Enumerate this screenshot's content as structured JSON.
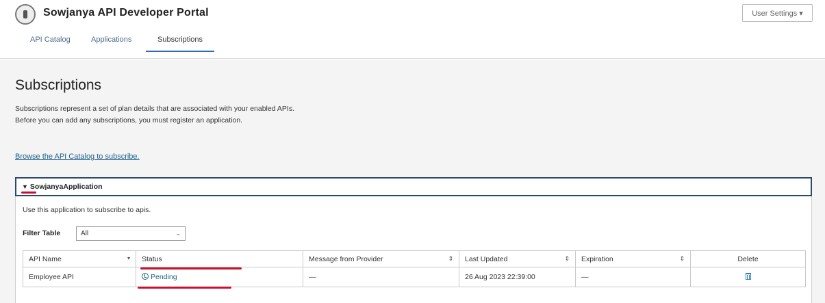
{
  "header": {
    "title": "Sowjanya API Developer Portal",
    "user_settings": "User Settings ▾",
    "tabs": [
      {
        "label": "API Catalog"
      },
      {
        "label": "Applications"
      },
      {
        "label": "Subscriptions"
      }
    ]
  },
  "main": {
    "title": "Subscriptions",
    "description": "Subscriptions represent a set of plan details that are associated with your enabled APIs. Before you can add any subscriptions, you must register an application.",
    "browse_link": "Browse the API Catalog to subscribe."
  },
  "application": {
    "name": "SowjanyaApplication",
    "caret": "▼",
    "hint": "Use this application to subscribe to apis.",
    "filter_label": "Filter Table",
    "filter_value": "All",
    "filter_chevron": "⌄"
  },
  "table": {
    "columns": [
      "API Name",
      "Status",
      "Message from Provider",
      "Last Updated",
      "Expiration",
      "Delete"
    ],
    "sort_icons": [
      "▾",
      "⇕",
      "⇕",
      "⇕"
    ],
    "rows": [
      {
        "api_name": "Employee API",
        "status": "Pending",
        "message": "—",
        "last_updated": "26 Aug 2023 22:39:00",
        "expiration": "—"
      }
    ]
  },
  "colors": {
    "accent": "#2d6bb5",
    "link": "#1a5f8a",
    "highlight_red": "#c8102e",
    "panel_border": "#2b4a6b"
  },
  "icons": [
    "logo-icon",
    "caret-down-icon",
    "chevron-down-icon",
    "sort-icon",
    "clock-icon",
    "trash-icon"
  ]
}
